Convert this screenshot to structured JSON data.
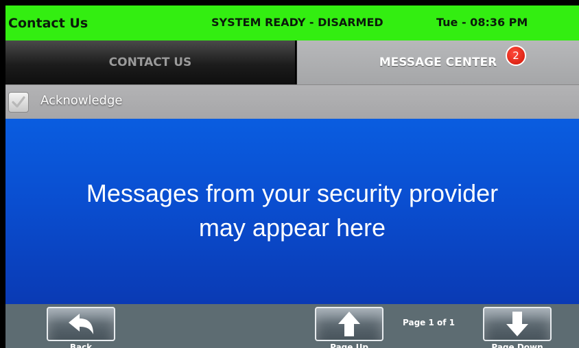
{
  "status_bar": {
    "title": "Contact Us",
    "system_status": "SYSTEM READY - DISARMED",
    "datetime": "Tue - 08:36 PM"
  },
  "tabs": [
    {
      "label": "CONTACT US",
      "active": false
    },
    {
      "label": "MESSAGE CENTER",
      "active": true,
      "badge": "2"
    }
  ],
  "acknowledge": {
    "label": "Acknowledge",
    "checked": true
  },
  "message": {
    "line1": "Messages from your security provider",
    "line2": "may appear here"
  },
  "bottom_bar": {
    "back_label": "Back",
    "page_up_label": "Page Up",
    "page_indicator": "Page 1 of 1",
    "page_down_label": "Page Down"
  },
  "colors": {
    "status_bar": "#33ee11",
    "message_area": "#0a4ed0",
    "badge": "#e01a0a",
    "bottom_bar": "#5d6c72"
  },
  "icons": {
    "back": "back-arrow-icon",
    "page_up": "arrow-up-icon",
    "page_down": "arrow-down-icon",
    "checkbox": "checkmark-icon"
  }
}
